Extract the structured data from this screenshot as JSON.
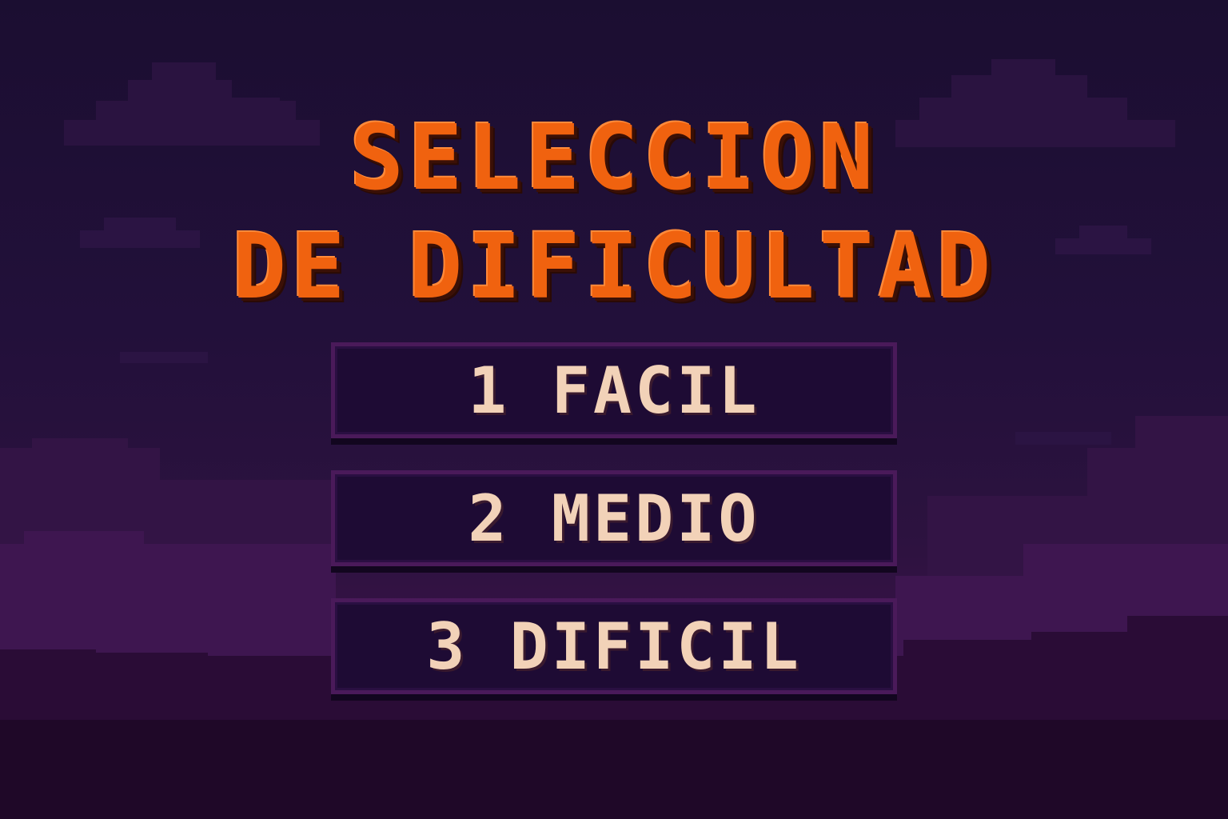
{
  "title": {
    "line1": "SELECCION",
    "line2": "DE DIFICULTAD"
  },
  "menu": {
    "options": [
      {
        "label": "1 FACIL"
      },
      {
        "label": "2 MEDIO"
      },
      {
        "label": "3 DIFICIL"
      }
    ]
  },
  "colors": {
    "title": "#f0620f",
    "button_text": "#f2d2b8",
    "button_bg": "#1e0b34",
    "button_border": "#4a1a5a",
    "sky_top": "#1b0e31",
    "hills": "#2a0f38"
  }
}
